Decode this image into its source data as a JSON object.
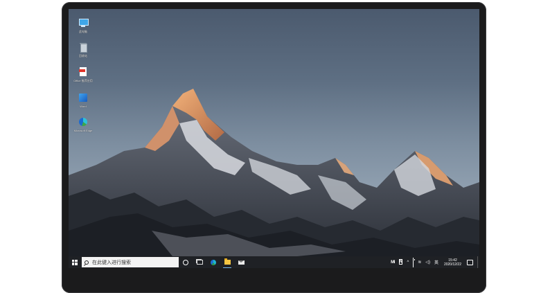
{
  "desktop": {
    "icons": [
      {
        "label": "此电脑",
        "icon": "computer-icon"
      },
      {
        "label": "回收站",
        "icon": "recycle-bin-icon"
      },
      {
        "label": "Office 推荐应用",
        "icon": "pdf-icon"
      },
      {
        "label": "Word",
        "icon": "word-icon"
      },
      {
        "label": "Microsoft Edge",
        "icon": "edge-icon"
      }
    ]
  },
  "taskbar": {
    "search_placeholder": "在此键入进行搜索",
    "apps": [
      "cortana-icon",
      "task-view-icon",
      "edge-icon",
      "file-explorer-icon",
      "mail-icon"
    ],
    "tray": {
      "mi_label": "MI",
      "n_label": "N",
      "chevron": "^",
      "wifi": "≋",
      "volume": "◁)",
      "ime": "英"
    },
    "clock": {
      "time": "15:42",
      "date": "2020/12/22"
    }
  },
  "colors": {
    "taskbar": "#1f2125",
    "frame": "#1b1b1c",
    "accent": "#76b9ed"
  }
}
